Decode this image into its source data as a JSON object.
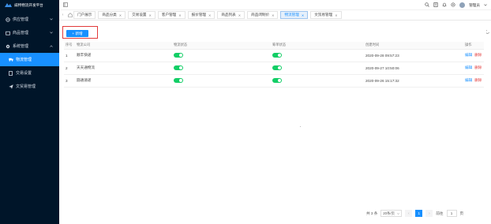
{
  "app": {
    "logo_text": "威特物流开发平台"
  },
  "sidebar": {
    "items": [
      {
        "label": "供应管理",
        "icon": "hand-icon"
      },
      {
        "label": "商品管理",
        "icon": "shop-icon"
      },
      {
        "label": "系统管理",
        "icon": "gear-icon"
      }
    ],
    "sub_items": [
      {
        "label": "物流管理",
        "icon": "truck-icon",
        "active": true
      },
      {
        "label": "交易设置",
        "icon": "doc-icon",
        "active": false
      },
      {
        "label": "文贸易管理",
        "icon": "send-icon",
        "active": false
      }
    ]
  },
  "header": {
    "user_name": "管理员"
  },
  "tabs": [
    {
      "label": "门户展示",
      "closable": false
    },
    {
      "label": "商品分类",
      "closable": true
    },
    {
      "label": "交易设置",
      "closable": true
    },
    {
      "label": "客户管理",
      "closable": true
    },
    {
      "label": "报价管理",
      "closable": true
    },
    {
      "label": "商品列表",
      "closable": true
    },
    {
      "label": "商品闭制价",
      "closable": true
    },
    {
      "label": "物流管理",
      "closable": true,
      "active": true
    },
    {
      "label": "文贸易管理",
      "closable": true
    }
  ],
  "toolbar": {
    "add_label": "+ 新增"
  },
  "table": {
    "headers": [
      "序号",
      "物流公司",
      "物流状态",
      "筹单状态",
      "创建时间",
      "操作"
    ],
    "rows": [
      {
        "idx": "1",
        "name": "顺丰快递",
        "time": "2020-09-28 09:57:23"
      },
      {
        "idx": "2",
        "name": "天天通物流",
        "time": "2020-09-27 10:50:06"
      },
      {
        "idx": "3",
        "name": "圆通速递",
        "time": "2020-09-26 15:17:32"
      }
    ],
    "edit_label": "编辑",
    "delete_label": "删除"
  },
  "pagination": {
    "total": "共 3 条",
    "page_size": "20条/页",
    "current": "1",
    "goto_label": "前往",
    "goto_value": "1",
    "page_unit": "页"
  },
  "colors": {
    "sidebar_bg": "#001529",
    "accent": "#1890ff",
    "switch_on": "#13ce66",
    "danger": "#e23a3a"
  }
}
